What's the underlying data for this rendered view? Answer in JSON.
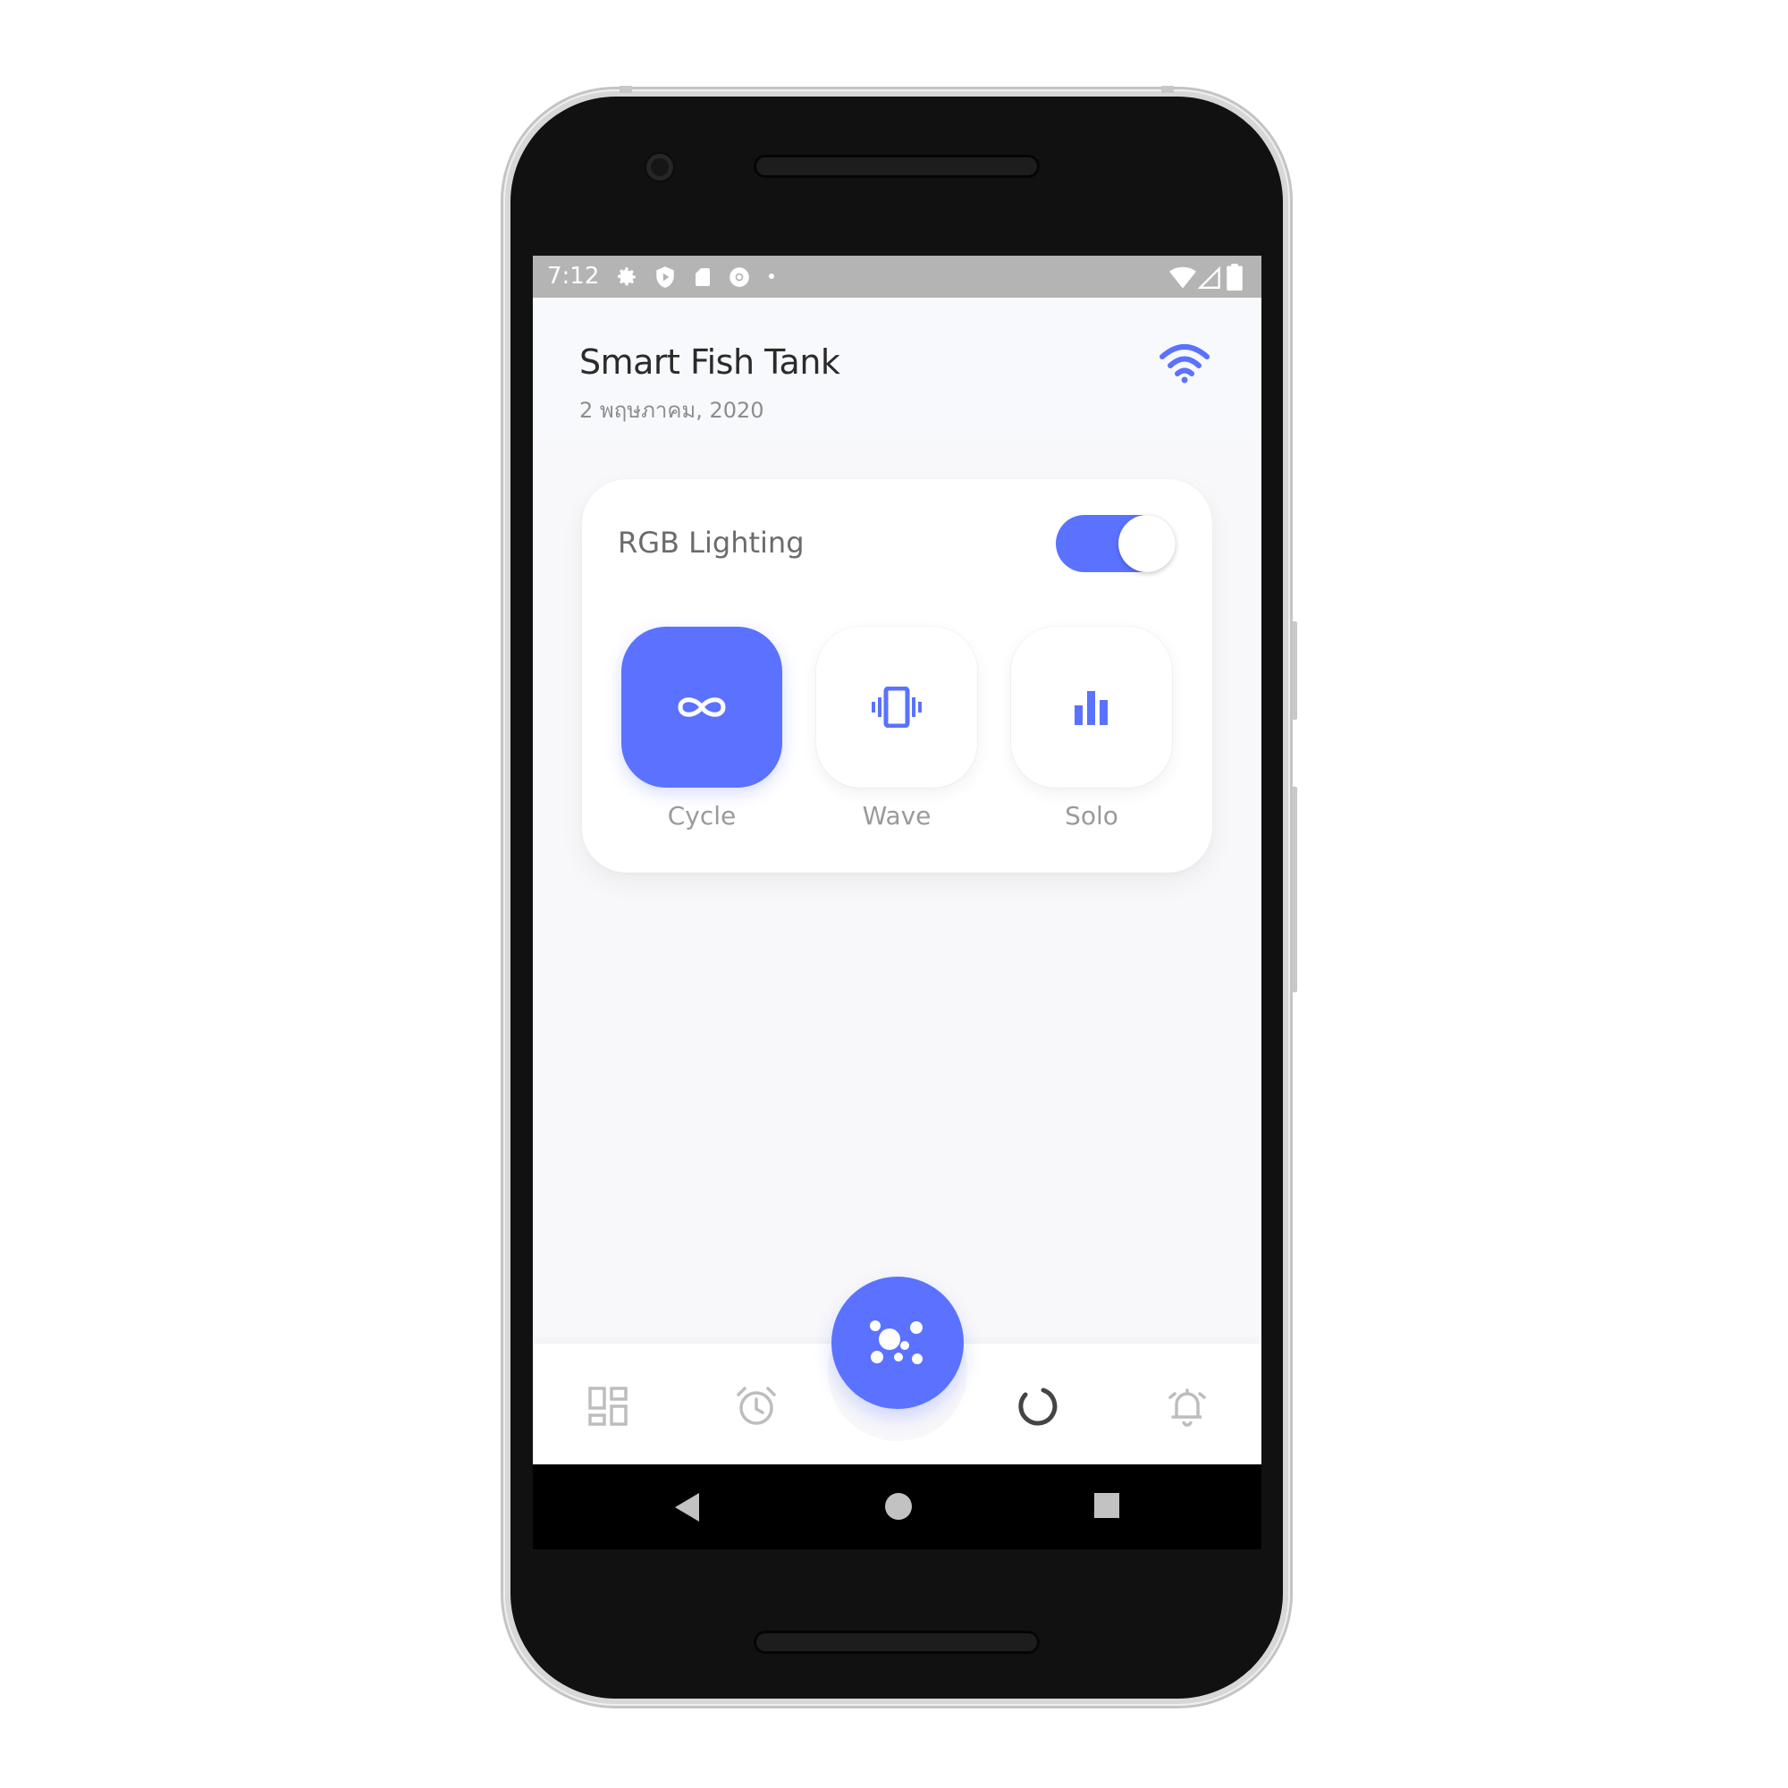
{
  "statusbar": {
    "time": "7:12",
    "left_icons": [
      "settings-icon",
      "shield-play-icon",
      "sd-card-icon",
      "chrome-icon",
      "dot-icon"
    ],
    "right_icons": [
      "wifi-signal-icon",
      "cell-signal-icon",
      "battery-icon"
    ]
  },
  "header": {
    "title": "Smart Fish Tank",
    "date": "2 พฤษภาคม, 2020",
    "wifi_icon": "wifi-icon"
  },
  "lighting": {
    "title": "RGB Lighting",
    "enabled": true,
    "modes": [
      {
        "label": "Cycle",
        "icon": "infinity-icon",
        "active": true
      },
      {
        "label": "Wave",
        "icon": "vibrate-icon",
        "active": false
      },
      {
        "label": "Solo",
        "icon": "bar-chart-icon",
        "active": false
      }
    ]
  },
  "bottom_nav": {
    "items": [
      "dashboard-icon",
      "alarm-clock-icon",
      "fab-bubbles-icon",
      "loading-ring-icon",
      "bell-icon"
    ]
  },
  "system_nav": [
    "back-icon",
    "home-icon",
    "recents-icon"
  ],
  "colors": {
    "accent": "#5a72ff",
    "statusbar": "#b4b4b4",
    "background": "#f8f8fa"
  }
}
